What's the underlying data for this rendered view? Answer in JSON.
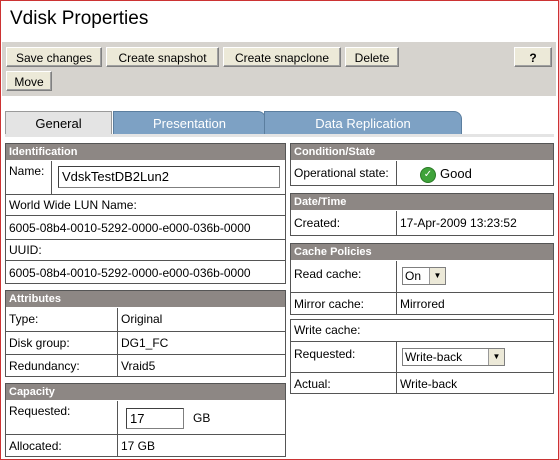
{
  "page": {
    "title": "Vdisk Properties"
  },
  "toolbar": {
    "save_changes": "Save changes",
    "create_snapshot": "Create snapshot",
    "create_snapclone": "Create snapclone",
    "delete": "Delete",
    "help": "?",
    "move": "Move"
  },
  "tabs": [
    "General",
    "Presentation",
    "Data Replication"
  ],
  "identification": {
    "header": "Identification",
    "name_label": "Name:",
    "name_value": "VdskTestDB2Lun2",
    "wwln_label": "World Wide LUN Name:",
    "wwln_value": "6005-08b4-0010-5292-0000-e000-036b-0000",
    "uuid_label": "UUID:",
    "uuid_value": "6005-08b4-0010-5292-0000-e000-036b-0000"
  },
  "attributes": {
    "header": "Attributes",
    "rows": [
      {
        "label": "Type:",
        "value": "Original"
      },
      {
        "label": "Disk group:",
        "value": "DG1_FC"
      },
      {
        "label": "Redundancy:",
        "value": "Vraid5"
      }
    ]
  },
  "capacity": {
    "header": "Capacity",
    "requested_label": "Requested:",
    "requested_value": "17",
    "requested_unit": "GB",
    "allocated_label": "Allocated:",
    "allocated_value": "17 GB"
  },
  "condition": {
    "header": "Condition/State",
    "operational_label": "Operational state:",
    "operational_value": "Good",
    "icon": "check-circle-icon",
    "status_color": "#3fa33a"
  },
  "datetime": {
    "header": "Date/Time",
    "created_label": "Created:",
    "created_value": "17-Apr-2009 13:23:52"
  },
  "cache": {
    "header": "Cache Policies",
    "read_label": "Read cache:",
    "read_value": "On",
    "mirror_label": "Mirror cache:",
    "mirror_value": "Mirrored",
    "write_label": "Write cache:",
    "requested_label": "Requested:",
    "requested_value": "Write-back",
    "actual_label": "Actual:",
    "actual_value": "Write-back"
  }
}
